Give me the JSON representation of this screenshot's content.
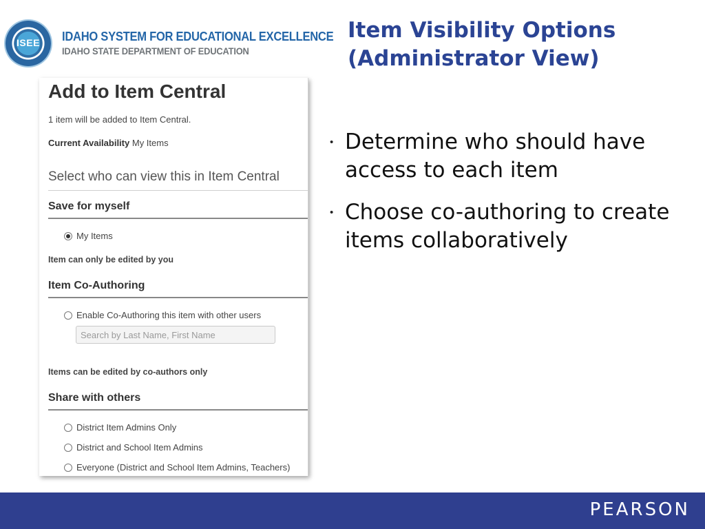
{
  "logo": {
    "seal_text": "ISEE",
    "line1": "IDAHO SYSTEM FOR EDUCATIONAL EXCELLENCE",
    "line2": "IDAHO STATE DEPARTMENT OF EDUCATION",
    "colors": {
      "primary": "#2466a8",
      "secondary": "#6f7478"
    }
  },
  "slide": {
    "title_line1": "Item Visibility Options",
    "title_line2": "(Administrator View)",
    "title_color": "#2b4494",
    "bullets": [
      "Determine who should have access to each item",
      "Choose co-authoring to create items collaboratively"
    ]
  },
  "dialog": {
    "title": "Add to Item Central",
    "note": "1 item will be added to Item Central.",
    "availability_label": "Current Availability",
    "availability_value": "My Items",
    "select_heading": "Select who can view this in Item Central",
    "sections": {
      "save_for_myself": {
        "heading": "Save for myself",
        "option": "My Items",
        "option_checked": true,
        "note": "Item can only be edited by you"
      },
      "co_authoring": {
        "heading": "Item Co-Authoring",
        "option": "Enable Co-Authoring this item with other users",
        "option_checked": false,
        "search_placeholder": "Search by Last Name, First Name",
        "search_value": "",
        "note": "Items can be edited by co-authors only"
      },
      "share_with_others": {
        "heading": "Share with others",
        "options": [
          "District Item Admins Only",
          "District and School Item Admins",
          "Everyone (District and School Item Admins, Teachers)"
        ]
      }
    }
  },
  "footer": {
    "brand": "PEARSON",
    "color": "#2f3f8f"
  }
}
